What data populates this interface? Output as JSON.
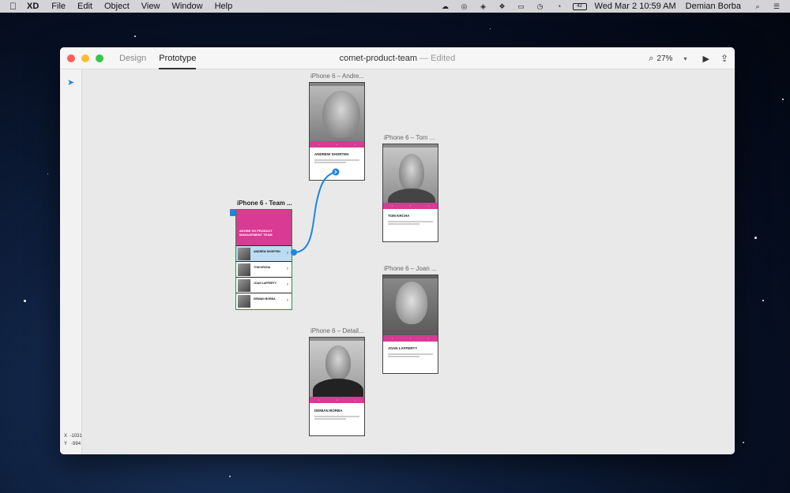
{
  "menubar": {
    "app": "XD",
    "menus": [
      "File",
      "Edit",
      "Object",
      "View",
      "Window",
      "Help"
    ],
    "battery": "42",
    "clock": "Wed Mar 2  10:59 AM",
    "user": "Demian Borba"
  },
  "window": {
    "tabs": {
      "design": "Design",
      "prototype": "Prototype"
    },
    "doc_title": "comet-product-team",
    "doc_status": "— Edited",
    "zoom": "27%",
    "coords": {
      "x_label": "X",
      "x": "-1031",
      "y_label": "Y",
      "y": "-994"
    }
  },
  "artboards": {
    "team": {
      "label": "iPhone 6 - Team ...",
      "title": "ADOBE XD PRODUCT MANAGEMENT TEAM",
      "rows": [
        {
          "name": "ANDREW SHORTEN",
          "sub": ""
        },
        {
          "name": "TOM KRCHA",
          "sub": ""
        },
        {
          "name": "JOAN LAFFERTY",
          "sub": ""
        },
        {
          "name": "DEMIAN BORBA",
          "sub": ""
        }
      ]
    },
    "andrew": {
      "label": "iPhone 6 – Andre...",
      "name": "ANDREW SHORTEN"
    },
    "tom": {
      "label": "iPhone 6 – Tom ...",
      "name": "TOM KRCHA"
    },
    "joan": {
      "label": "iPhone 6 – Joan ...",
      "name": "JOAN LAFFERTY"
    },
    "detail": {
      "label": "iPhone 6 – Detail...",
      "name": "DEMIAN BORBA"
    }
  },
  "colors": {
    "accent": "#1e86e0",
    "brand_pink": "#d83a94",
    "selection_green": "#2c8a44"
  }
}
